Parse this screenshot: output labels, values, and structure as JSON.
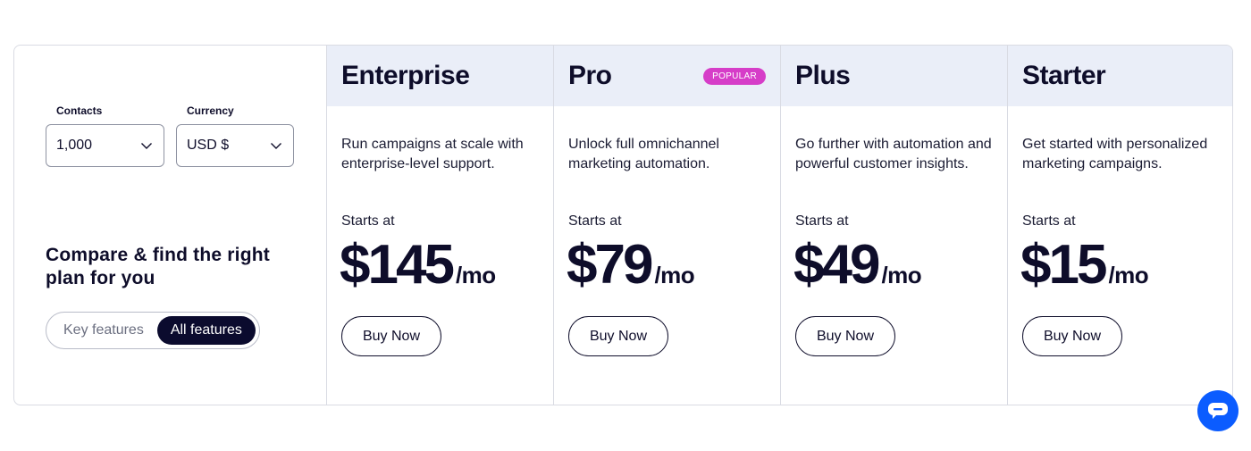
{
  "filters": {
    "contacts_label": "Contacts",
    "contacts_value": "1,000",
    "currency_label": "Currency",
    "currency_value": "USD $"
  },
  "compare_title": "Compare & find the right plan for you",
  "feature_toggle": {
    "options": [
      "Key features",
      "All features"
    ],
    "selected": "All features"
  },
  "plans": [
    {
      "name": "Enterprise",
      "description": "Run campaigns at scale with enterprise-level support.",
      "starts_at": "Starts at",
      "price": "$145",
      "period": "/mo",
      "cta": "Buy Now"
    },
    {
      "name": "Pro",
      "badge": "POPULAR",
      "description": "Unlock full omnichannel marketing automation.",
      "starts_at": "Starts at",
      "price": "$79",
      "period": "/mo",
      "cta": "Buy Now"
    },
    {
      "name": "Plus",
      "description": "Go further with automation and powerful customer insights.",
      "starts_at": "Starts at",
      "price": "$49",
      "period": "/mo",
      "cta": "Buy Now"
    },
    {
      "name": "Starter",
      "description": "Get started with personalized marketing campaigns.",
      "starts_at": "Starts at",
      "price": "$15",
      "period": "/mo",
      "cta": "Buy Now"
    }
  ],
  "chat_icon": "chat-bubble-icon",
  "colors": {
    "ink": "#0e0d2a",
    "header_bg": "#eaeef8",
    "popular_badge": "#d63dc8",
    "toggle_active": "#0b0b2e",
    "chat_button": "#0b5cff"
  }
}
